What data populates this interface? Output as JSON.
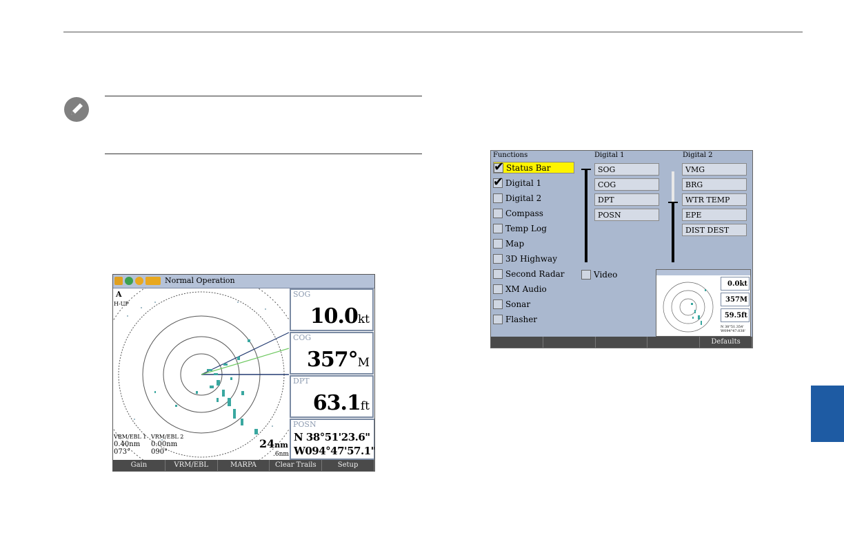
{
  "radar_screen": {
    "status_title": "Normal Operation",
    "orientation": "H-UP",
    "north_marker": "A",
    "vrm1": {
      "label": "VRM/EBL 1",
      "range": "0.40nm",
      "bearing": "073°"
    },
    "vrm2": {
      "label": "VRM/EBL 2",
      "range": "0.00nm",
      "bearing": "090°"
    },
    "range": "24",
    "range_unit": "nm",
    "range_sub": ".6nm",
    "sog": {
      "label": "SOG",
      "value": "10.0",
      "unit": "kt"
    },
    "cog": {
      "label": "COG",
      "value": "357°",
      "unit": "M"
    },
    "dpt": {
      "label": "DPT",
      "value": "63.1",
      "unit": "ft"
    },
    "posn": {
      "label": "POSN",
      "lat": "N  38°51'23.6\"",
      "lon": "W094°47'57.1\""
    },
    "softkeys": [
      "Gain",
      "VRM/EBL",
      "MARPA",
      "Clear Trails",
      "Setup"
    ]
  },
  "setup_screen": {
    "functions_header": "Functions",
    "digital1_header": "Digital 1",
    "digital2_header": "Digital 2",
    "functions": [
      {
        "label": "Status Bar",
        "checked": true,
        "selected": true
      },
      {
        "label": "Digital 1",
        "checked": true,
        "selected": false
      },
      {
        "label": "Digital 2",
        "checked": false,
        "selected": false
      },
      {
        "label": "Compass",
        "checked": false,
        "selected": false
      },
      {
        "label": "Temp Log",
        "checked": false,
        "selected": false
      },
      {
        "label": "Map",
        "checked": false,
        "selected": false
      },
      {
        "label": "3D Highway",
        "checked": false,
        "selected": false
      },
      {
        "label": "Second Radar",
        "checked": false,
        "selected": false
      },
      {
        "label": "XM Audio",
        "checked": false,
        "selected": false
      },
      {
        "label": "Sonar",
        "checked": false,
        "selected": false
      },
      {
        "label": "Flasher",
        "checked": false,
        "selected": false
      }
    ],
    "video_label": "Video",
    "digital1_fields": [
      "SOG",
      "COG",
      "DPT",
      "POSN"
    ],
    "digital2_fields": [
      "VMG",
      "BRG",
      "WTR TEMP",
      "EPE",
      "DIST DEST"
    ],
    "preview": {
      "sog": "0.0kt",
      "cog": "357M",
      "dpt": "59.5ft",
      "posn": "N  38°51.354' W094°47.038'"
    },
    "softkeys": [
      "",
      "",
      "",
      "",
      "Defaults"
    ]
  },
  "colors": {
    "accent_tab": "#1e5ba3",
    "selection": "#fef400",
    "radar_echo": "#3aa7a0"
  }
}
